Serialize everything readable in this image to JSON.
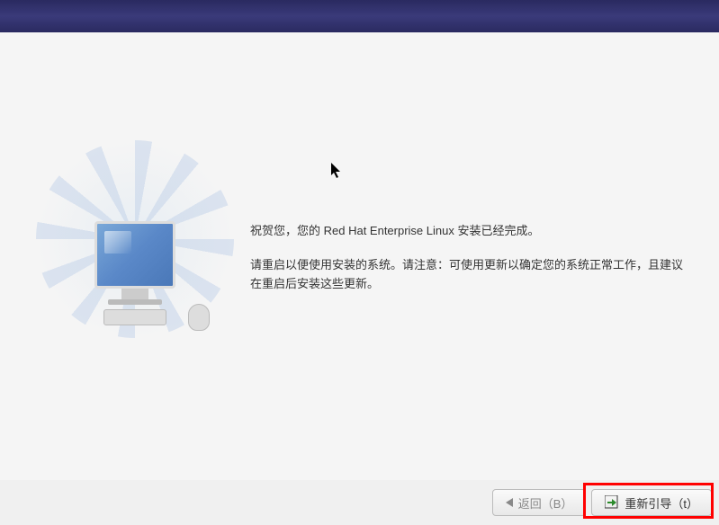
{
  "message": {
    "congratulations": "祝贺您，您的 Red Hat Enterprise Linux 安装已经完成。",
    "instructions": "请重启以便使用安装的系统。请注意：可使用更新以确定您的系统正常工作，且建议在重启后安装这些更新。"
  },
  "buttons": {
    "back": "返回（B）",
    "reboot": "重新引导（t）"
  }
}
